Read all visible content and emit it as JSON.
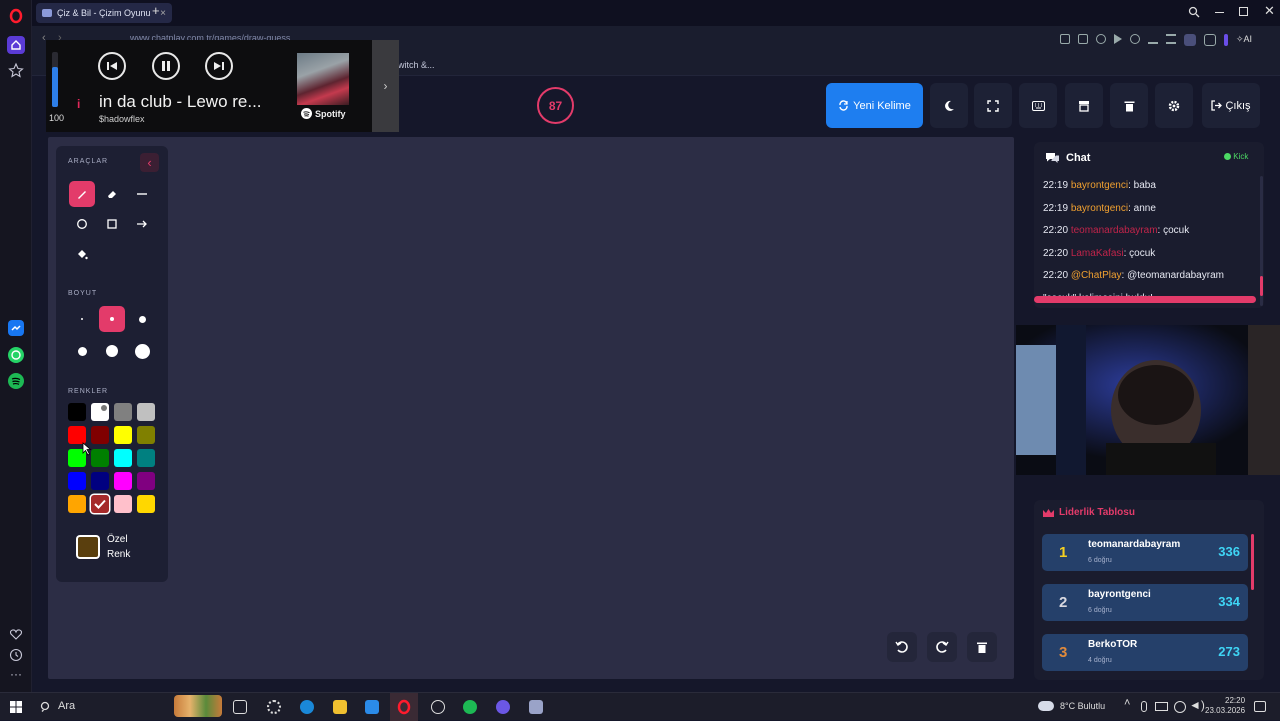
{
  "browser": {
    "tab_title": "Çiz & Bil - Çizim Oyunu",
    "tab_close": "×",
    "new_tab": "+",
    "url": "www.chatplay.com.tr/games/draw-guess",
    "bookmark_text": "witch &..."
  },
  "player": {
    "volume": "100",
    "volume_level": 0.73,
    "info": "i",
    "track": "in da club - Lewo re...",
    "artist": "$hadowflex",
    "service": "Spotify",
    "expand": "›"
  },
  "header": {
    "timer": "87",
    "new_word": "Yeni Kelime",
    "logout": "Çıkış"
  },
  "tools": {
    "tools_title": "ARAÇLAR",
    "size_title": "BOYUT",
    "colors_title": "RENKLER",
    "custom_color_line1": "Özel",
    "custom_color_line2": "Renk",
    "custom_color": "#5a3f0e",
    "palette": [
      "#000000",
      "#ffffff",
      "#808080",
      "#c0c0c0",
      "#ff0000",
      "#800000",
      "#ffff00",
      "#808000",
      "#00ff00",
      "#008000",
      "#00ffff",
      "#008080",
      "#0000ff",
      "#000080",
      "#ff00ff",
      "#800080",
      "#ffa500",
      "#a52a2a",
      "#ffc0cb",
      "#ffd700"
    ]
  },
  "chat": {
    "title": "Chat",
    "platform": "Kick",
    "messages": [
      {
        "time": "22:19",
        "user": "bayrontgenci",
        "user_color": "#f0a030",
        "text": ": baba"
      },
      {
        "time": "22:19",
        "user": "bayrontgenci",
        "user_color": "#f0a030",
        "text": ": anne"
      },
      {
        "time": "22:20",
        "user": "teomanardabayram",
        "user_color": "#c0244a",
        "text": ": çocuk"
      },
      {
        "time": "22:20",
        "user": "LamaKafasi",
        "user_color": "#c0244a",
        "text": ": çocuk"
      },
      {
        "time": "22:20",
        "user": "@ChatPlay",
        "user_color": "#f0a030",
        "text": ": @teomanardabayram"
      },
      {
        "time": "",
        "user": "",
        "user_color": "#ffffff",
        "text": "\"çocuk\" kelimesini buldu!"
      }
    ]
  },
  "leaderboard": {
    "title": "Liderlik Tablosu",
    "rows": [
      {
        "rank": "1",
        "name": "teomanardabayram",
        "sub": "6 doğru",
        "score": "336",
        "rank_color": "#f5d020"
      },
      {
        "rank": "2",
        "name": "bayrontgenci",
        "sub": "6 doğru",
        "score": "334",
        "rank_color": "#d8d8e0"
      },
      {
        "rank": "3",
        "name": "BerkoTOR",
        "sub": "4 doğru",
        "score": "273",
        "rank_color": "#e08a3c"
      }
    ]
  },
  "taskbar": {
    "search": "Ara",
    "weather": "8°C  Bulutlu",
    "time": "22:20",
    "date": "23.03.2026"
  }
}
